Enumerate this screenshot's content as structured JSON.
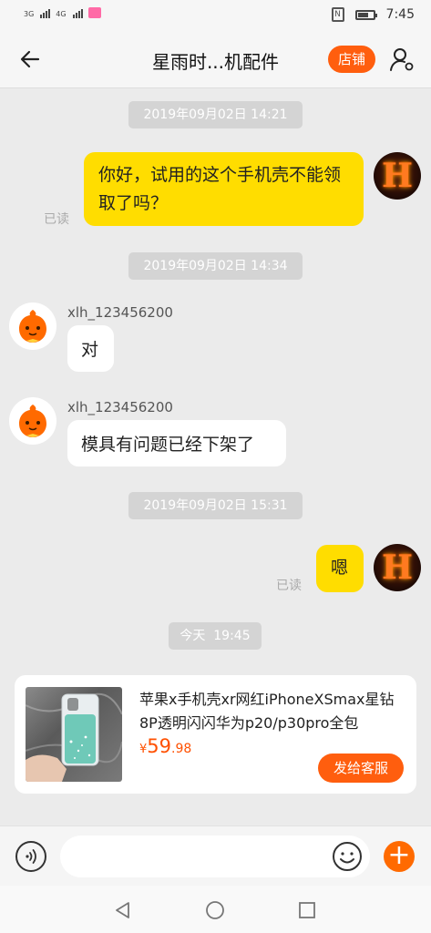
{
  "status_bar": {
    "time": "7:45",
    "signal1_label": "3G",
    "signal2_label": "4G",
    "nfc_label": "N"
  },
  "header": {
    "title": "星雨时...机配件",
    "shop_label": "店铺"
  },
  "messages": {
    "time1": "2019年09月02日 14:21",
    "me1": "你好，试用的这个手机壳不能领取了吗？",
    "read1": "已读",
    "time2": "2019年09月02日 14:34",
    "user1": "xlh_123456200",
    "you1": "对",
    "user2": "xlh_123456200",
    "you2": "模具有问题已经下架了",
    "time3": "2019年09月02日 15:31",
    "me2": "嗯",
    "read2": "已读",
    "time4": "今天  19:45"
  },
  "product_card": {
    "title": "苹果x手机壳xr网红iPhoneXSmax星钻8P透明闪闪华为p20/p30pro全包",
    "currency": "¥",
    "price_int": "59",
    "price_dec": ".98",
    "send_label": "发给客服"
  },
  "input_bar": {
    "placeholder": ""
  },
  "colors": {
    "accent": "#ff5e0e",
    "bubble_me": "#ffdd00",
    "background": "#ebebeb"
  }
}
